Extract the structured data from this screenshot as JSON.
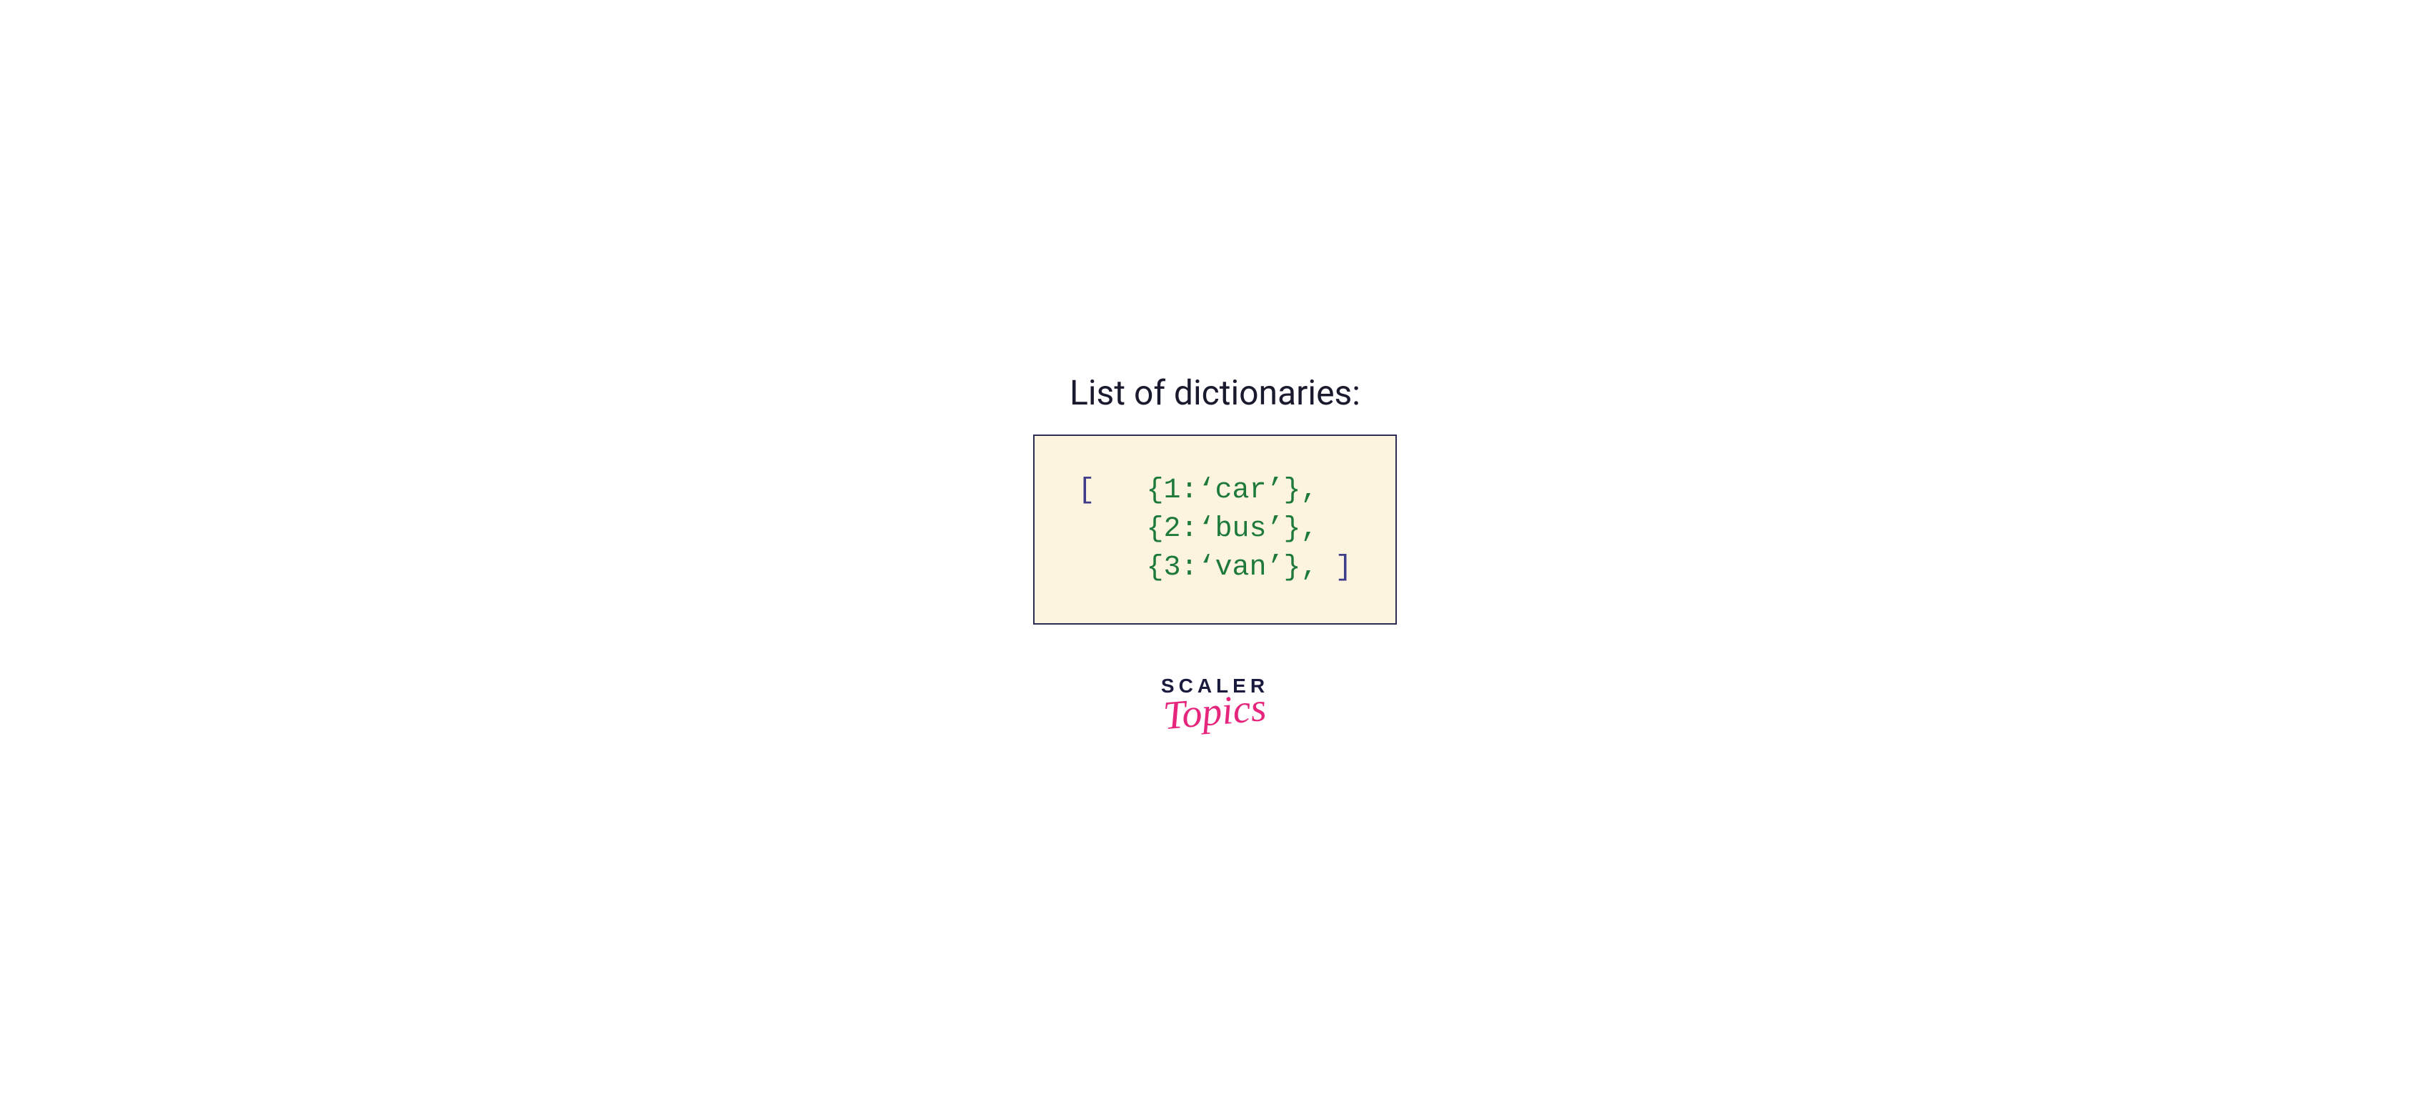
{
  "title": "List of dictionaries:",
  "code": {
    "open_bracket": "[",
    "close_bracket": "]",
    "entries": [
      {
        "key": "1",
        "value": "car"
      },
      {
        "key": "2",
        "value": "bus"
      },
      {
        "key": "3",
        "value": "van"
      }
    ],
    "line1_prefix": "[   ",
    "line1": "{1:‘car’},",
    "line2_prefix": "    ",
    "line2": "{2:‘bus’},",
    "line3_prefix": "    ",
    "line3": "{3:‘van’}, ",
    "line3_suffix": "]"
  },
  "logo": {
    "primary": "SCALER",
    "secondary": "Topics"
  },
  "colors": {
    "box_bg": "#fdf4e0",
    "box_border": "#2c2c54",
    "bracket": "#3d3d8a",
    "dict_text": "#1e7a3a",
    "title": "#1a1a2e",
    "logo_primary": "#1a1a3e",
    "logo_secondary": "#e6267d"
  }
}
